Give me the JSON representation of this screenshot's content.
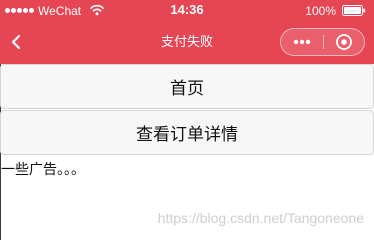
{
  "status_bar": {
    "carrier": "WeChat",
    "time": "14:36",
    "battery": "100%"
  },
  "nav": {
    "title": "支付失败"
  },
  "buttons": {
    "home": "首页",
    "order_detail": "查看订单详情"
  },
  "content": {
    "ad_text": "一些广告。。。"
  },
  "watermark": "https://blog.csdn.net/Tangoneone",
  "colors": {
    "nav_background": "#e64553",
    "button_background": "#f7f7f7",
    "text": "#111111"
  },
  "icons": [
    "signal-dots-icon",
    "wifi-icon",
    "battery-icon",
    "back-chevron-icon",
    "more-dots-icon",
    "close-target-icon"
  ]
}
